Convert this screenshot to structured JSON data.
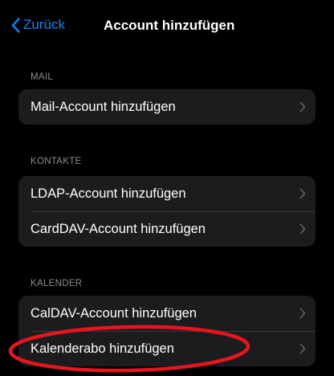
{
  "nav": {
    "back_label": "Zurück",
    "title": "Account hinzufügen"
  },
  "sections": [
    {
      "header": "MAIL",
      "items": [
        {
          "label": "Mail-Account hinzufügen"
        }
      ]
    },
    {
      "header": "KONTAKTE",
      "items": [
        {
          "label": "LDAP-Account hinzufügen"
        },
        {
          "label": "CardDAV-Account hinzufügen"
        }
      ]
    },
    {
      "header": "KALENDER",
      "items": [
        {
          "label": "CalDAV-Account hinzufügen"
        },
        {
          "label": "Kalenderabo hinzufügen"
        }
      ]
    }
  ],
  "icons": {
    "back": "chevron-left-icon",
    "row_disclosure": "chevron-right-icon"
  },
  "colors": {
    "background": "#000000",
    "accent": "#0a84ff",
    "cell_background": "#1c1c1e",
    "separator": "#38383a",
    "secondary_text": "#8d8d93",
    "chevron": "#5a5a5f",
    "highlight_annotation": "#e8141e"
  }
}
